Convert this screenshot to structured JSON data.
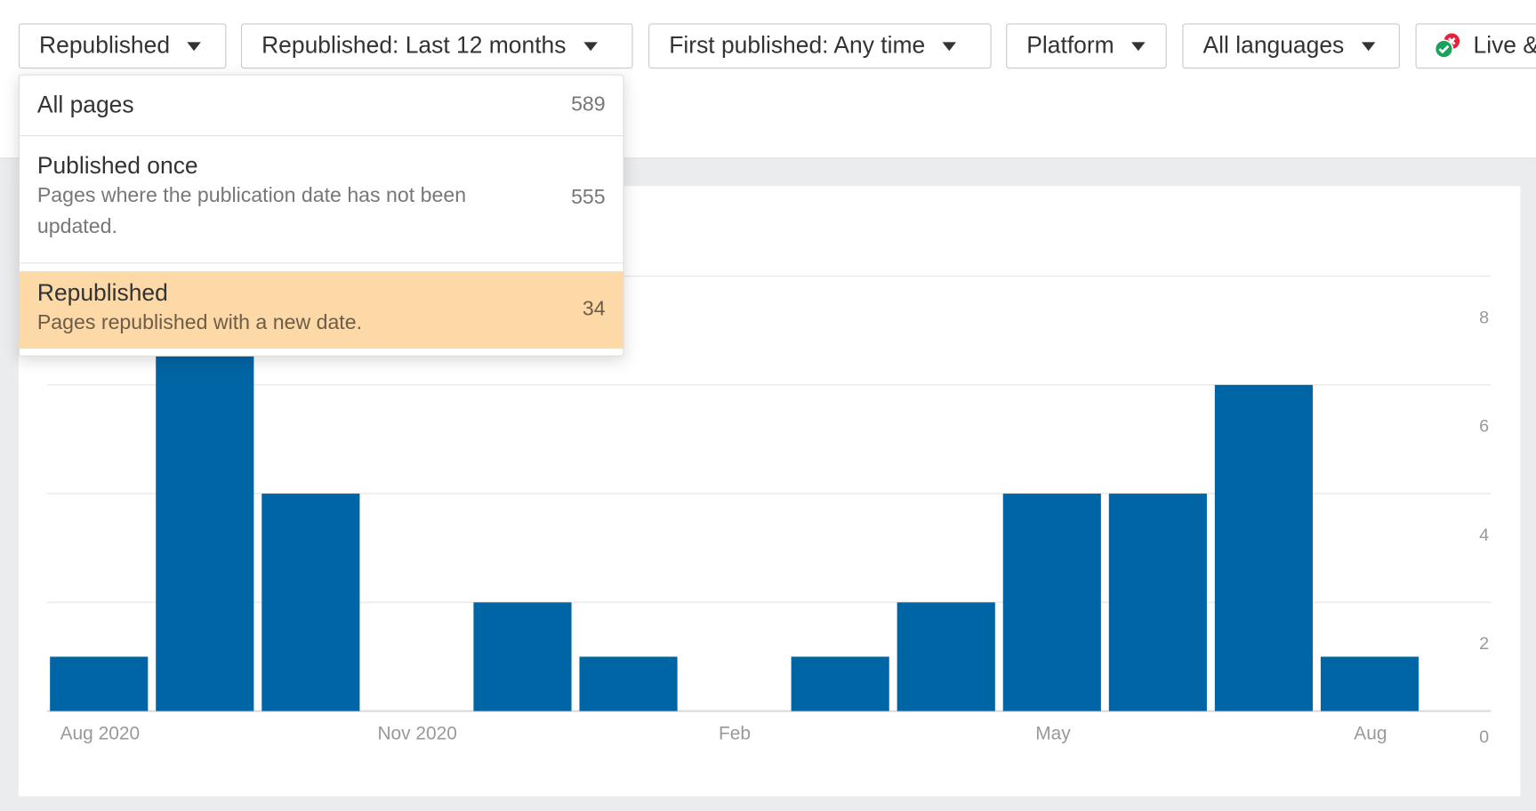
{
  "filters": [
    {
      "label": "Republished"
    },
    {
      "label": "Republished: Last 12 months"
    },
    {
      "label": "First published: Any time"
    },
    {
      "label": "Platform"
    },
    {
      "label": "All languages"
    },
    {
      "label": "Live &"
    }
  ],
  "dropdown": {
    "items": [
      {
        "title": "All pages",
        "description": "",
        "count": "589"
      },
      {
        "title": "Published once",
        "description": "Pages where the publication date has not been updated.",
        "count": "555"
      },
      {
        "title": "Republished",
        "description": "Pages republished with a new date.",
        "count": "34",
        "selected": true
      }
    ],
    "highlight_color": "#fdd9a8"
  },
  "chart_data": {
    "type": "bar",
    "categories": [
      "Aug 2020",
      "Sep 2020",
      "Oct 2020",
      "Nov 2020",
      "Dec 2020",
      "Jan 2021",
      "Feb 2021",
      "Mar 2021",
      "Apr 2021",
      "May 2021",
      "Jun 2021",
      "Jul 2021",
      "Aug 2021"
    ],
    "values": [
      1,
      8,
      4,
      0,
      2,
      1,
      0,
      1,
      2,
      4,
      4,
      6,
      1
    ],
    "x_tick_labels": [
      "Aug 2020",
      "Nov 2020",
      "Feb",
      "May",
      "Aug"
    ],
    "y_ticks": [
      0,
      2,
      4,
      6,
      8
    ],
    "ylim": [
      0,
      8
    ],
    "grid": true,
    "bar_color": "#0065a4",
    "y_axis_side": "right"
  }
}
